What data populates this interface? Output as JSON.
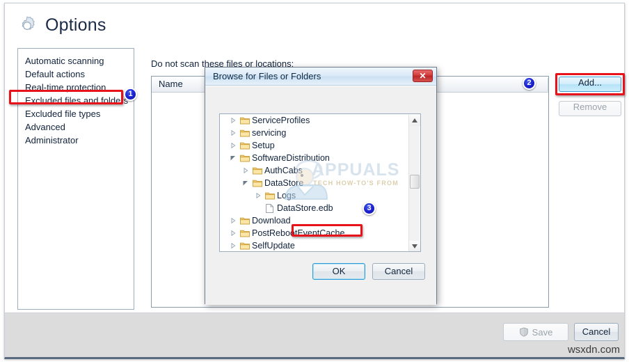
{
  "window": {
    "title": "Options",
    "title_icon": "gear-icon"
  },
  "sidebar": {
    "items": [
      {
        "label": "Automatic scanning"
      },
      {
        "label": "Default actions"
      },
      {
        "label": "Real-time protection"
      },
      {
        "label": "Excluded files and folders"
      },
      {
        "label": "Excluded file types"
      },
      {
        "label": "Advanced"
      },
      {
        "label": "Administrator"
      }
    ],
    "selected_index": 3
  },
  "content": {
    "label": "Do not scan these files or locations:",
    "list_columns": [
      "Name"
    ],
    "list_rows": [],
    "add_label": "Add...",
    "remove_label": "Remove"
  },
  "footer": {
    "save_label": "Save",
    "save_icon": "shield-icon",
    "cancel_label": "Cancel"
  },
  "dialog": {
    "title": "Browse for Files or Folders",
    "close_label": "✕",
    "ok_label": "OK",
    "cancel_label": "Cancel",
    "tree": [
      {
        "label": "ServiceProfiles",
        "depth": 1,
        "icon": "folder-icon",
        "arrow": "collapsed",
        "selected": false
      },
      {
        "label": "servicing",
        "depth": 1,
        "icon": "folder-icon",
        "arrow": "collapsed",
        "selected": false
      },
      {
        "label": "Setup",
        "depth": 1,
        "icon": "folder-icon",
        "arrow": "collapsed",
        "selected": false
      },
      {
        "label": "SoftwareDistribution",
        "depth": 1,
        "icon": "folder-icon",
        "arrow": "expanded",
        "selected": false
      },
      {
        "label": "AuthCabs",
        "depth": 2,
        "icon": "folder-icon",
        "arrow": "collapsed",
        "selected": false
      },
      {
        "label": "DataStore",
        "depth": 2,
        "icon": "folder-icon",
        "arrow": "expanded",
        "selected": false
      },
      {
        "label": "Logs",
        "depth": 3,
        "icon": "folder-icon",
        "arrow": "collapsed",
        "selected": false
      },
      {
        "label": "DataStore.edb",
        "depth": 3,
        "icon": "file-icon",
        "arrow": "none",
        "selected": true
      },
      {
        "label": "Download",
        "depth": 1,
        "icon": "folder-icon",
        "arrow": "collapsed",
        "selected": false
      },
      {
        "label": "PostRebootEventCache",
        "depth": 1,
        "icon": "folder-icon",
        "arrow": "collapsed",
        "selected": false
      },
      {
        "label": "SelfUpdate",
        "depth": 1,
        "icon": "folder-icon",
        "arrow": "collapsed",
        "selected": false
      }
    ]
  },
  "badges": [
    {
      "number": "1",
      "target": "sidebar-item-excluded-files-and-folders"
    },
    {
      "number": "2",
      "target": "add-button"
    },
    {
      "number": "3",
      "target": "tree-item-datastore-edb"
    }
  ],
  "watermarks": {
    "brand": "APPUALS",
    "tagline": "TECH HOW-TO'S FROM",
    "site": "wsxdn.com"
  },
  "colors": {
    "highlight_red": "#e8121a",
    "badge_blue": "#1a1fcf",
    "accent_blue": "#2e9ad6"
  }
}
